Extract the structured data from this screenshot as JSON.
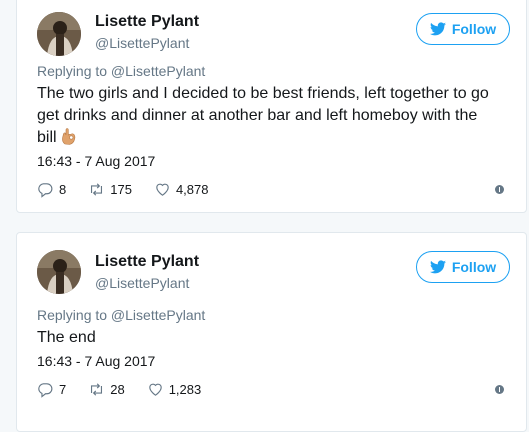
{
  "tweets": [
    {
      "display_name": "Lisette Pylant",
      "handle": "@LisettePylant",
      "follow_label": "Follow",
      "replying_to": "Replying to @LisettePylant",
      "text": "The two girls and I decided to be best friends, left together to go get drinks and dinner at another bar and left homeboy with the bill",
      "emoji": "ok-hand-icon",
      "timestamp": "16:43 - 7 Aug 2017",
      "replies": "8",
      "retweets": "175",
      "likes": "4,878"
    },
    {
      "display_name": "Lisette Pylant",
      "handle": "@LisettePylant",
      "follow_label": "Follow",
      "replying_to": "Replying to @LisettePylant",
      "text": "The end",
      "timestamp": "16:43 - 7 Aug 2017",
      "replies": "7",
      "retweets": "28",
      "likes": "1,283"
    }
  ],
  "colors": {
    "accent": "#1da1f2",
    "muted": "#657786",
    "border": "#e1e8ed",
    "background": "#f5f8fa"
  }
}
